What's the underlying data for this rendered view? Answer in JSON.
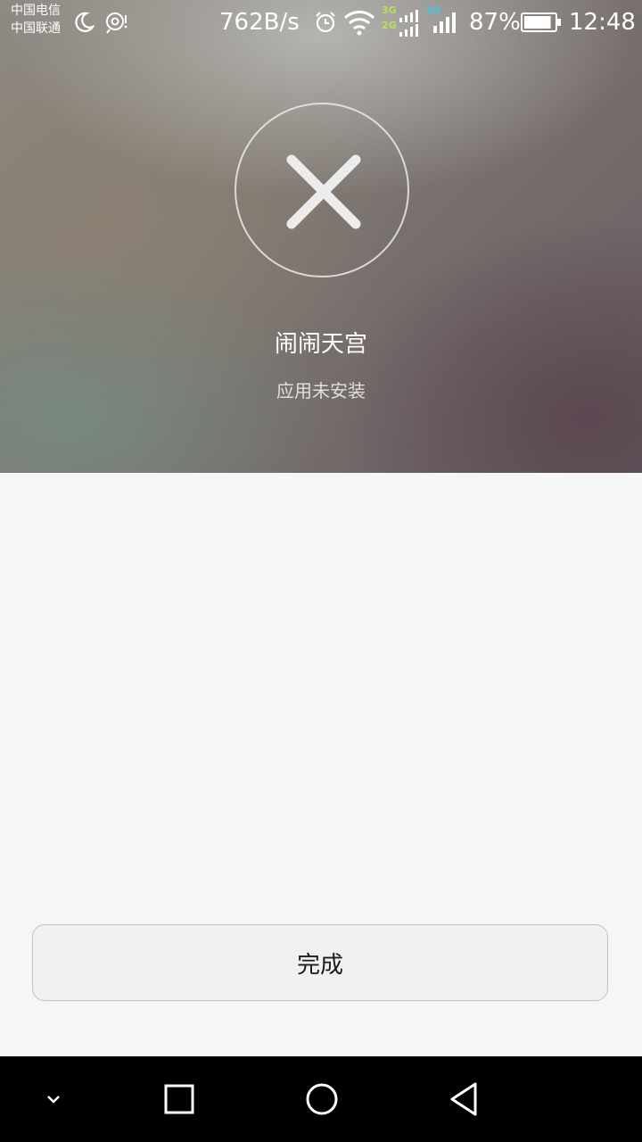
{
  "status_bar": {
    "carrier_1": "中国电信",
    "carrier_2": "中国联通",
    "net_speed": "762B/s",
    "sim1_tag_top": "3G",
    "sim1_tag_bottom": "2G",
    "sim2_tag": "2G",
    "battery_percent": "87%",
    "battery_level": 0.87,
    "time": "12:48",
    "icons": [
      "moon-icon",
      "hotspot-icon",
      "alarm-icon",
      "wifi-icon",
      "signal-icon",
      "signal-icon",
      "battery-icon"
    ]
  },
  "result": {
    "icon": "close-icon",
    "app_name": "闹闹天宫",
    "status": "应用未安装"
  },
  "actions": {
    "done_label": "完成"
  },
  "nav_bar": {
    "icons": [
      "chevron-down-icon",
      "recents-icon",
      "home-icon",
      "back-icon"
    ]
  },
  "colors": {
    "background": "#f6f6f6",
    "navbar": "#000000",
    "button_bg": "#f1f1f1",
    "tag_3g": "#b6e25a",
    "tag_2g": "#3fc7e6"
  }
}
